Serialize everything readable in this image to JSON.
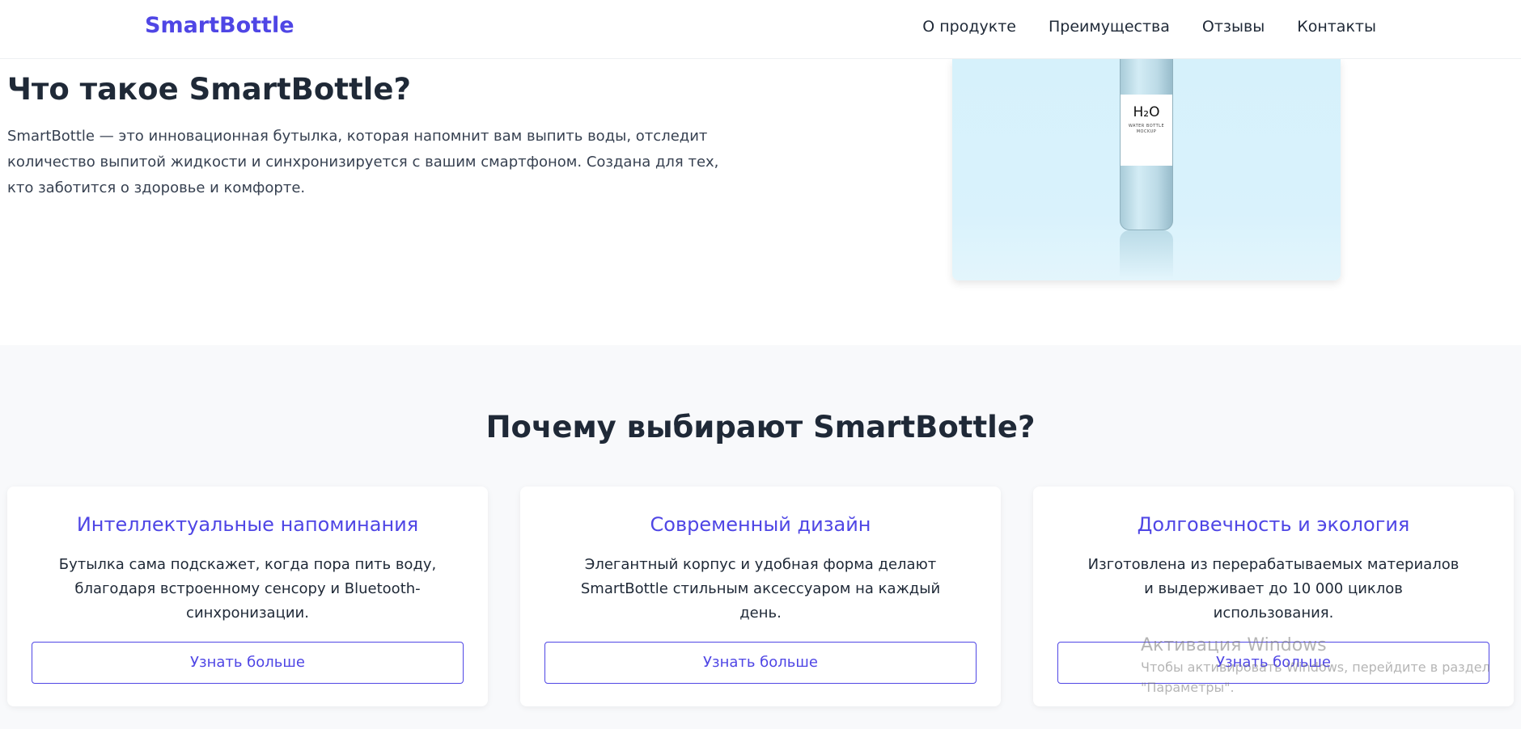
{
  "header": {
    "logo": "SmartBottle",
    "nav": [
      "О продукте",
      "Преимущества",
      "Отзывы",
      "Контакты"
    ]
  },
  "about": {
    "title": "Что такое SmartBottle?",
    "text": "SmartBottle — это инновационная бутылка, которая напомнит вам выпить воды, отследит количество выпитой жидкости и синхронизируется с вашим смартфоном. Создана для тех, кто заботится о здоровье и комфорте.",
    "image": {
      "label_main": "H₂O",
      "label_sub": "WATER BOTTLE MOCKUP"
    }
  },
  "features": {
    "title": "Почему выбирают SmartBottle?",
    "cards": [
      {
        "title": "Интеллектуальные напоминания",
        "text": "Бутылка сама подскажет, когда пора пить воду, благодаря встроенному сенсору и Bluetooth-синхронизации.",
        "button": "Узнать больше"
      },
      {
        "title": "Современный дизайн",
        "text": "Элегантный корпус и удобная форма делают SmartBottle стильным аксессуаром на каждый день.",
        "button": "Узнать больше"
      },
      {
        "title": "Долговечность и экология",
        "text": "Изготовлена из перерабатываемых материалов и выдерживает до 10 000 циклов использования.",
        "button": "Узнать больше"
      }
    ]
  },
  "watermark": {
    "title": "Активация Windows",
    "text": "Чтобы активировать Windows, перейдите в раздел \"Параметры\"."
  },
  "colors": {
    "accent": "#4f46e5",
    "text_dark": "#1f2937",
    "features_bg": "#f8f9fb",
    "image_bg": "#d6f1fb"
  }
}
